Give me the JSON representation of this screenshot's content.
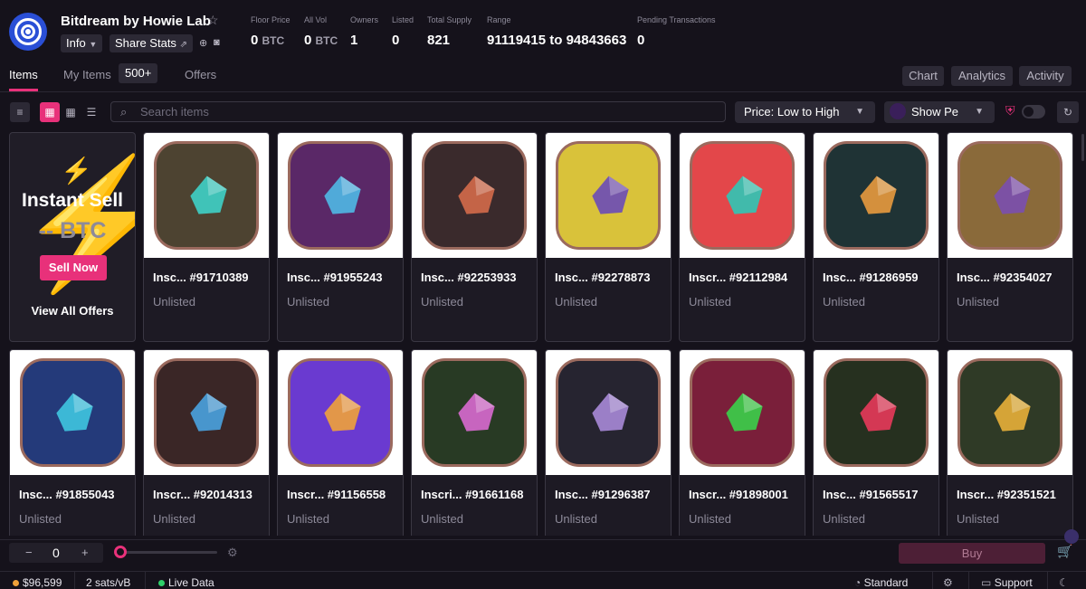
{
  "collection": {
    "title": "Bitdream by Howie Lab",
    "info_label": "Info",
    "share_label": "Share Stats"
  },
  "stats": [
    {
      "label": "Floor Price",
      "value": "0",
      "unit": "BTC"
    },
    {
      "label": "All Vol",
      "value": "0",
      "unit": "BTC"
    },
    {
      "label": "Owners",
      "value": "1",
      "unit": ""
    },
    {
      "label": "Listed",
      "value": "0",
      "unit": ""
    },
    {
      "label": "Total Supply",
      "value": "821",
      "unit": ""
    },
    {
      "label": "Range",
      "value": "91119415 to 94843663",
      "unit": ""
    },
    {
      "label": "Pending Transactions",
      "value": "0",
      "unit": ""
    }
  ],
  "tabs": {
    "items": "Items",
    "my_items": "My Items",
    "my_items_count": "500+",
    "offers": "Offers"
  },
  "right_buttons": {
    "chart": "Chart",
    "analytics": "Analytics",
    "activity": "Activity"
  },
  "toolbar": {
    "search_placeholder": "Search items",
    "sort_value": "Price: Low to High",
    "show_value": "Show Pe"
  },
  "instant_sell": {
    "title": "Instant Sell",
    "price": "-- BTC",
    "button": "Sell Now",
    "link": "View All Offers"
  },
  "items": [
    {
      "name": "Insc... #91710389",
      "status": "Unlisted",
      "bg": "#4d4331",
      "shape": "#3fd2c8"
    },
    {
      "name": "Insc... #91955243",
      "status": "Unlisted",
      "bg": "#5a2867",
      "shape": "#4fb8e6"
    },
    {
      "name": "Insc... #92253933",
      "status": "Unlisted",
      "bg": "#3a2a2c",
      "shape": "#d46a4a"
    },
    {
      "name": "Insc... #92278873",
      "status": "Unlisted",
      "bg": "#d9c23a",
      "shape": "#6a4bb8"
    },
    {
      "name": "Inscr... #92112984",
      "status": "Unlisted",
      "bg": "#e3474a",
      "shape": "#2fc6b6"
    },
    {
      "name": "Insc... #91286959",
      "status": "Unlisted",
      "bg": "#1f3335",
      "shape": "#e89a3e"
    },
    {
      "name": "Insc... #92354027",
      "status": "Unlisted",
      "bg": "#8a6a3a",
      "shape": "#7a4fb0"
    },
    {
      "name": "Insc... #91855043",
      "status": "Unlisted",
      "bg": "#243a7a",
      "shape": "#3fc6e0"
    },
    {
      "name": "Inscr... #92014313",
      "status": "Unlisted",
      "bg": "#3a2626",
      "shape": "#4aa3e0"
    },
    {
      "name": "Inscr... #91156558",
      "status": "Unlisted",
      "bg": "#6a3ad0",
      "shape": "#f0a23a"
    },
    {
      "name": "Inscri... #91661168",
      "status": "Unlisted",
      "bg": "#283a24",
      "shape": "#d86ad0"
    },
    {
      "name": "Insc... #91296387",
      "status": "Unlisted",
      "bg": "#262430",
      "shape": "#a98ad8"
    },
    {
      "name": "Inscr... #91898001",
      "status": "Unlisted",
      "bg": "#7a1f3a",
      "shape": "#3ad04a"
    },
    {
      "name": "Insc... #91565517",
      "status": "Unlisted",
      "bg": "#26301f",
      "shape": "#e83a5a"
    },
    {
      "name": "Inscr... #92351521",
      "status": "Unlisted",
      "bg": "#2f3a26",
      "shape": "#e8b03a"
    }
  ],
  "buy_bar": {
    "quantity": "0",
    "minus": "−",
    "plus": "+",
    "buy_label": "Buy"
  },
  "status_bar": {
    "btc_price": "$96,599",
    "fee": "2 sats/vB",
    "live": "Live Data",
    "mode": "Standard",
    "support": "Support"
  },
  "colors": {
    "accent": "#e8317a",
    "background": "#15121b",
    "live_dot": "#2fd06a",
    "coin": "#f0a23a"
  }
}
